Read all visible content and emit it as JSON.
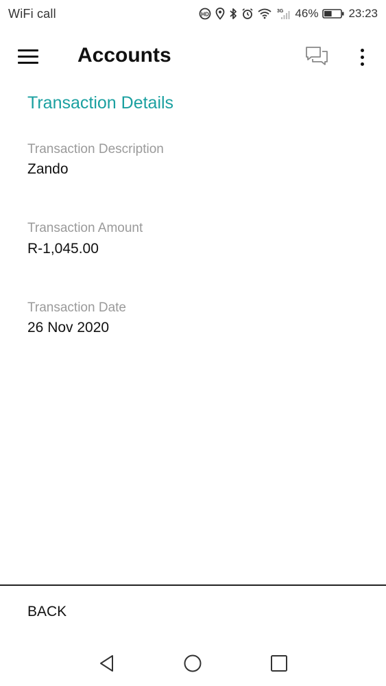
{
  "status_bar": {
    "carrier": "WiFi call",
    "network_type": "3G",
    "battery_percent": "46%",
    "battery_level": 0.46,
    "time": "23:23",
    "icons": [
      "hd-call-icon",
      "location-icon",
      "bluetooth-icon",
      "alarm-icon",
      "wifi-icon",
      "signal-icon",
      "battery-icon"
    ]
  },
  "app_bar": {
    "title": "Accounts",
    "icons": [
      "menu-icon",
      "chat-icon",
      "more-vertical-icon"
    ]
  },
  "details": {
    "section_title": "Transaction Details",
    "fields": [
      {
        "label": "Transaction Description",
        "value": "Zando"
      },
      {
        "label": "Transaction Amount",
        "value": "R-1,045.00"
      },
      {
        "label": "Transaction Date",
        "value": "26 Nov 2020"
      }
    ]
  },
  "footer": {
    "back_label": "BACK"
  },
  "nav_bar": {
    "icons": [
      "nav-back-icon",
      "nav-home-icon",
      "nav-recent-icon"
    ]
  },
  "colors": {
    "accent": "#1aa0a0",
    "label_gray": "#9a9a9a",
    "text": "#111111",
    "background": "#ffffff"
  }
}
